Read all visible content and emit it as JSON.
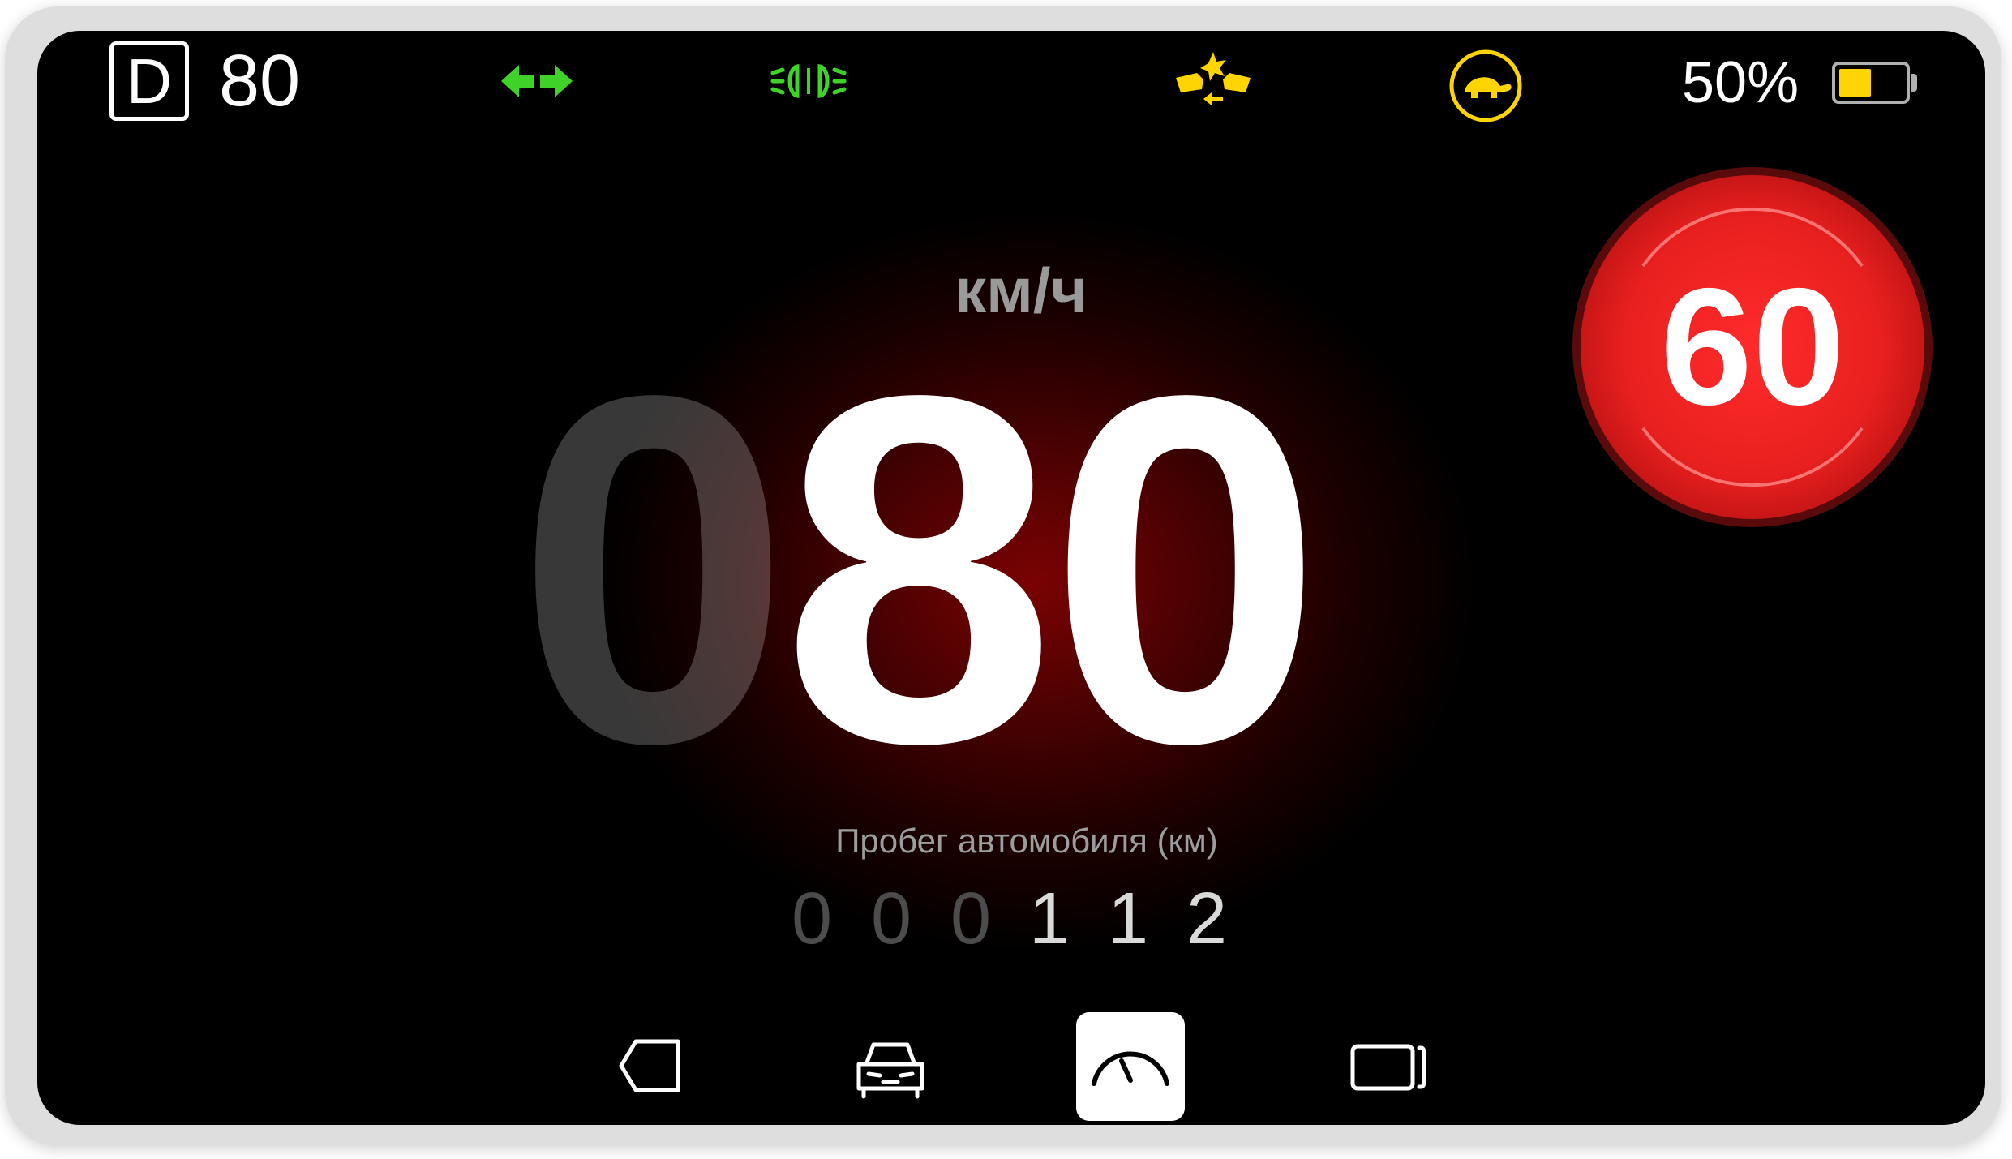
{
  "status_bar": {
    "gear": "D",
    "speed": "80",
    "battery_percent_label": "50%",
    "battery_level": 0.5,
    "indicators": [
      {
        "icon": "turn-signals-icon",
        "color": "#3fd32a"
      },
      {
        "icon": "headlights-icon",
        "color": "#3fd32a"
      },
      {
        "icon": "traction-control-icon",
        "color": "#ffd400"
      },
      {
        "icon": "turtle-mode-icon",
        "color": "#ffd400"
      }
    ]
  },
  "speedometer": {
    "unit": "км/ч",
    "leading_digit": "0",
    "speed": "80"
  },
  "speed_limit": {
    "value": "60",
    "color": "#e8201f"
  },
  "odometer": {
    "label": "Пробег автомобиля (км)",
    "digits": [
      "0",
      "0",
      "0",
      "1",
      "1",
      "2"
    ],
    "dim_count": 3
  },
  "bottom_nav": [
    {
      "icon": "back-icon",
      "active": false
    },
    {
      "icon": "car-icon",
      "active": false
    },
    {
      "icon": "speedometer-icon",
      "active": true
    },
    {
      "icon": "screen-mirror-icon",
      "active": false
    }
  ]
}
